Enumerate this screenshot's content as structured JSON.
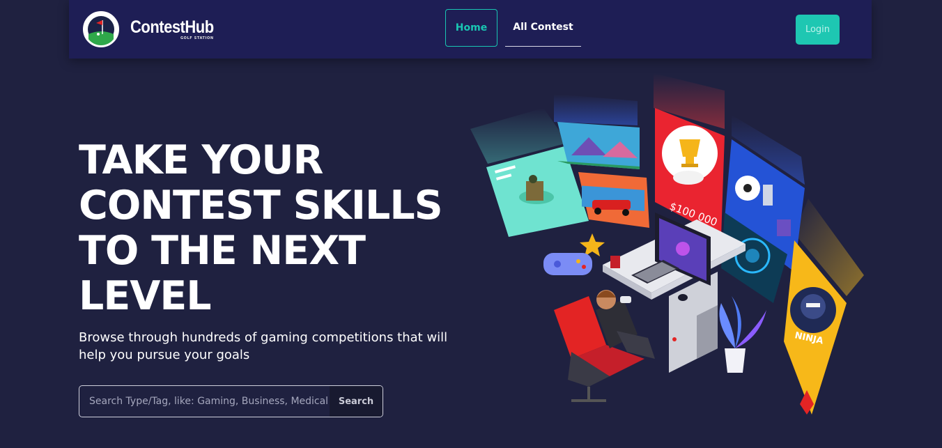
{
  "navbar": {
    "brand_name": "ContestHub",
    "brand_sub": "GOLF STATION",
    "links": [
      {
        "label": "Home",
        "active": true
      },
      {
        "label": "All Contest",
        "active": false
      }
    ],
    "login_label": "Login"
  },
  "hero": {
    "title": "TAKE YOUR CONTEST SKILLS TO THE NEXT LEVEL",
    "subtitle": "Browse through hundreds of gaming competitions that will help you pursue your goals",
    "search": {
      "placeholder": "Search Type/Tag, like: Gaming, Business, Medical",
      "button_label": "Search"
    },
    "illustration": {
      "prize_text": "$100 000",
      "ninja_text": "NINJA"
    }
  },
  "colors": {
    "background": "#1f2140",
    "navbar": "#1e1e55",
    "accent": "#19c7b3"
  },
  "icons": [
    "golf-flag-logo-icon",
    "trophy-icon",
    "soccer-ball-icon",
    "gamepad-icon",
    "star-icon"
  ]
}
